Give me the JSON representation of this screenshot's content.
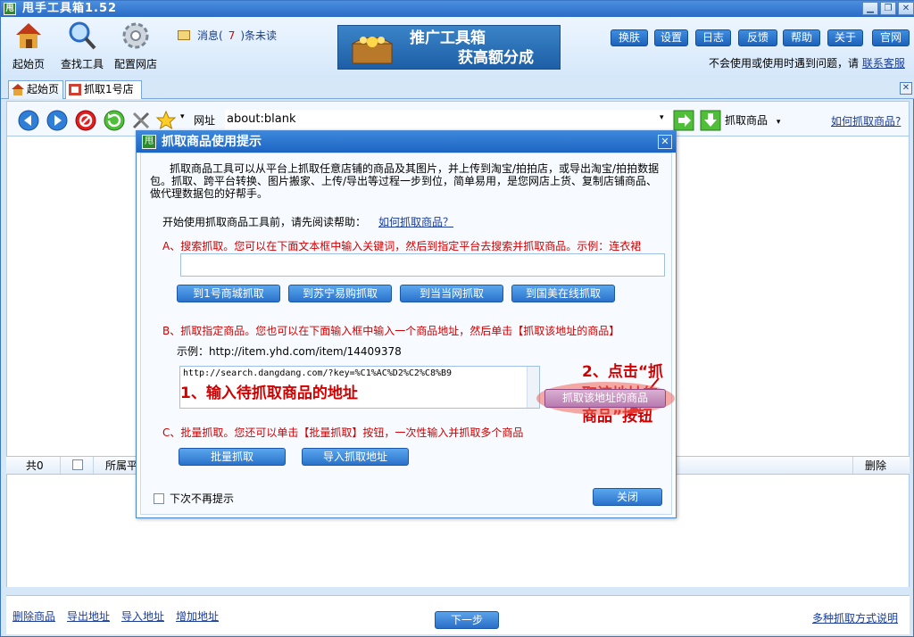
{
  "app": {
    "title": "甩手工具箱1.52",
    "icon_letter": "甩"
  },
  "toolbar": {
    "tools": [
      {
        "label": "起始页",
        "icon": "home-icon"
      },
      {
        "label": "查找工具",
        "icon": "search-icon"
      },
      {
        "label": "配置网店",
        "icon": "gear-icon"
      }
    ],
    "message_prefix": "消息(",
    "message_count": "7",
    "message_suffix": ")条未读",
    "banner_line1": "推广工具箱",
    "banner_line2": "获高额分成",
    "buttons": [
      "换肤",
      "设置",
      "日志",
      "反馈",
      "帮助",
      "关于",
      "官网"
    ],
    "help_text": "不会使用或使用时遇到问题，请",
    "help_link": "联系客服"
  },
  "tabs": [
    {
      "label": "起始页",
      "icon": "home-icon"
    },
    {
      "label": "抓取1号店",
      "icon": "grab-icon"
    }
  ],
  "addressbar": {
    "label": "网址",
    "url": "about:blank",
    "grab_label": "抓取商品",
    "help_link": "如何抓取商品?"
  },
  "list": {
    "count_label": "共0",
    "col_store": "所属平",
    "col_delete": "删除"
  },
  "bottom": {
    "links": [
      "删除商品",
      "导出地址",
      "导入地址",
      "增加地址"
    ],
    "next": "下一步",
    "methods_link": "多种抓取方式说明"
  },
  "dialog": {
    "title": "抓取商品使用提示",
    "intro": "抓取商品工具可以从平台上抓取任意店铺的商品及其图片，并上传到淘宝/拍拍店，或导出淘宝/拍拍数据包。抓取、跨平台转换、图片搬家、上传/导出等过程一步到位，简单易用，是您网店上货、复制店铺商品、做代理数据包的好帮手。",
    "help_prefix": "开始使用抓取商品工具前，请先阅读帮助：",
    "help_link": "如何抓取商品？",
    "section_a": "A、搜索抓取。您可以在下面文本框中输入关键词，然后到指定平台去搜索并抓取商品。示例：连衣裙",
    "a_buttons": [
      "到1号商城抓取",
      "到苏宁易购抓取",
      "到当当网抓取",
      "到国美在线抓取"
    ],
    "section_b": "B、抓取指定商品。您也可以在下面输入框中输入一个商品地址，然后单击【抓取该地址的商品】",
    "b_example": "示例：http://item.yhd.com/item/14409378",
    "b_url": "http://search.dangdang.com/?key=%C1%AC%D2%C2%C8%B9",
    "b_button": "抓取该地址的商品",
    "annotation1": "1、输入待抓取商品的地址",
    "annotation2": "2、点击“抓取该地址的商品”按钮",
    "section_c": "C、批量抓取。您还可以单击【批量抓取】按钮，一次性输入并抓取多个商品",
    "c_buttons": [
      "批量抓取",
      "导入抓取地址"
    ],
    "no_remind": "下次不再提示",
    "close": "关闭"
  }
}
